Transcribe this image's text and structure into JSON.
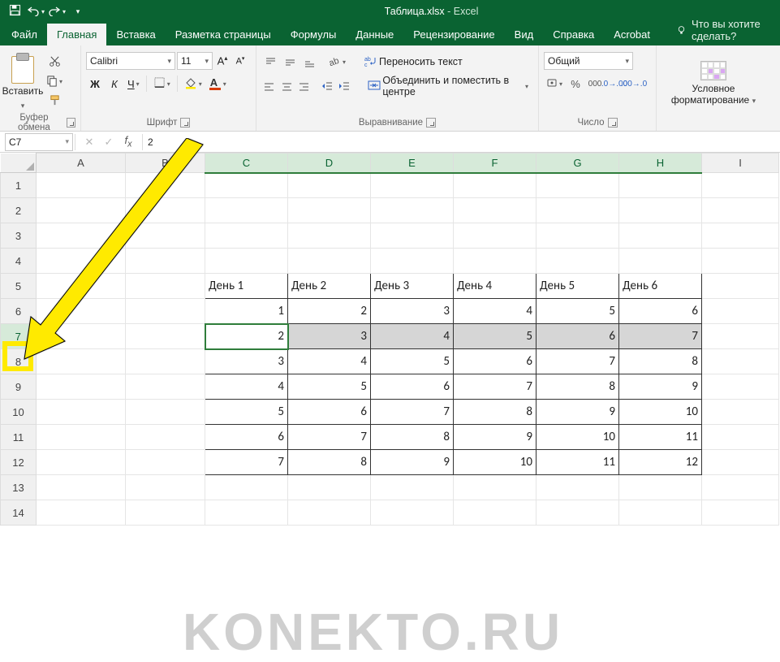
{
  "titlebar": {
    "filename": "Таблица.xlsx",
    "app": "Excel"
  },
  "tabs": {
    "file": "Файл",
    "items": [
      "Главная",
      "Вставка",
      "Разметка страницы",
      "Формулы",
      "Данные",
      "Рецензирование",
      "Вид",
      "Справка",
      "Acrobat"
    ],
    "active": "Главная",
    "tell_me": "Что вы хотите сделать?"
  },
  "ribbon": {
    "clipboard": {
      "paste": "Вставить",
      "label": "Буфер обмена"
    },
    "font": {
      "name": "Calibri",
      "size": "11",
      "bold": "Ж",
      "italic": "К",
      "underline": "Ч",
      "label": "Шрифт"
    },
    "alignment": {
      "wrap": "Переносить текст",
      "merge": "Объединить и поместить в центре",
      "label": "Выравнивание"
    },
    "number": {
      "format": "Общий",
      "label": "Число"
    },
    "cond": {
      "label_line1": "Условное",
      "label_line2": "форматирование"
    }
  },
  "formula_bar": {
    "name_box": "C7",
    "value": "2"
  },
  "grid": {
    "columns": [
      "A",
      "B",
      "C",
      "D",
      "E",
      "F",
      "G",
      "H",
      "I"
    ],
    "col_widths": {
      "A": 110,
      "B": 98,
      "C": 102,
      "D": 102,
      "E": 102,
      "F": 102,
      "G": 102,
      "H": 102,
      "I": 95
    },
    "selected_cols": [
      "C",
      "D",
      "E",
      "F",
      "G",
      "H"
    ],
    "selected_row": 7,
    "active_cell": "C7",
    "row_count": 14,
    "headers": {
      "row": 5,
      "cells": {
        "C": "День 1",
        "D": "День 2",
        "E": "День 3",
        "F": "День 4",
        "G": "День 5",
        "H": "День 6"
      }
    },
    "data_rows": [
      {
        "row": 6,
        "vals": {
          "C": 1,
          "D": 2,
          "E": 3,
          "F": 4,
          "G": 5,
          "H": 6
        }
      },
      {
        "row": 7,
        "vals": {
          "C": 2,
          "D": 3,
          "E": 4,
          "F": 5,
          "G": 6,
          "H": 7
        }
      },
      {
        "row": 8,
        "vals": {
          "C": 3,
          "D": 4,
          "E": 5,
          "F": 6,
          "G": 7,
          "H": 8
        }
      },
      {
        "row": 9,
        "vals": {
          "C": 4,
          "D": 5,
          "E": 6,
          "F": 7,
          "G": 8,
          "H": 9
        }
      },
      {
        "row": 10,
        "vals": {
          "C": 5,
          "D": 6,
          "E": 7,
          "F": 8,
          "G": 9,
          "H": 10
        }
      },
      {
        "row": 11,
        "vals": {
          "C": 6,
          "D": 7,
          "E": 8,
          "F": 9,
          "G": 10,
          "H": 11
        }
      },
      {
        "row": 12,
        "vals": {
          "C": 7,
          "D": 8,
          "E": 9,
          "F": 10,
          "G": 11,
          "H": 12
        }
      }
    ]
  },
  "watermark": "KONEKTO.RU",
  "chart_data": {
    "type": "table",
    "title": "",
    "columns": [
      "День 1",
      "День 2",
      "День 3",
      "День 4",
      "День 5",
      "День 6"
    ],
    "rows": [
      [
        1,
        2,
        3,
        4,
        5,
        6
      ],
      [
        2,
        3,
        4,
        5,
        6,
        7
      ],
      [
        3,
        4,
        5,
        6,
        7,
        8
      ],
      [
        4,
        5,
        6,
        7,
        8,
        9
      ],
      [
        5,
        6,
        7,
        8,
        9,
        10
      ],
      [
        6,
        7,
        8,
        9,
        10,
        11
      ],
      [
        7,
        8,
        9,
        10,
        11,
        12
      ]
    ]
  }
}
